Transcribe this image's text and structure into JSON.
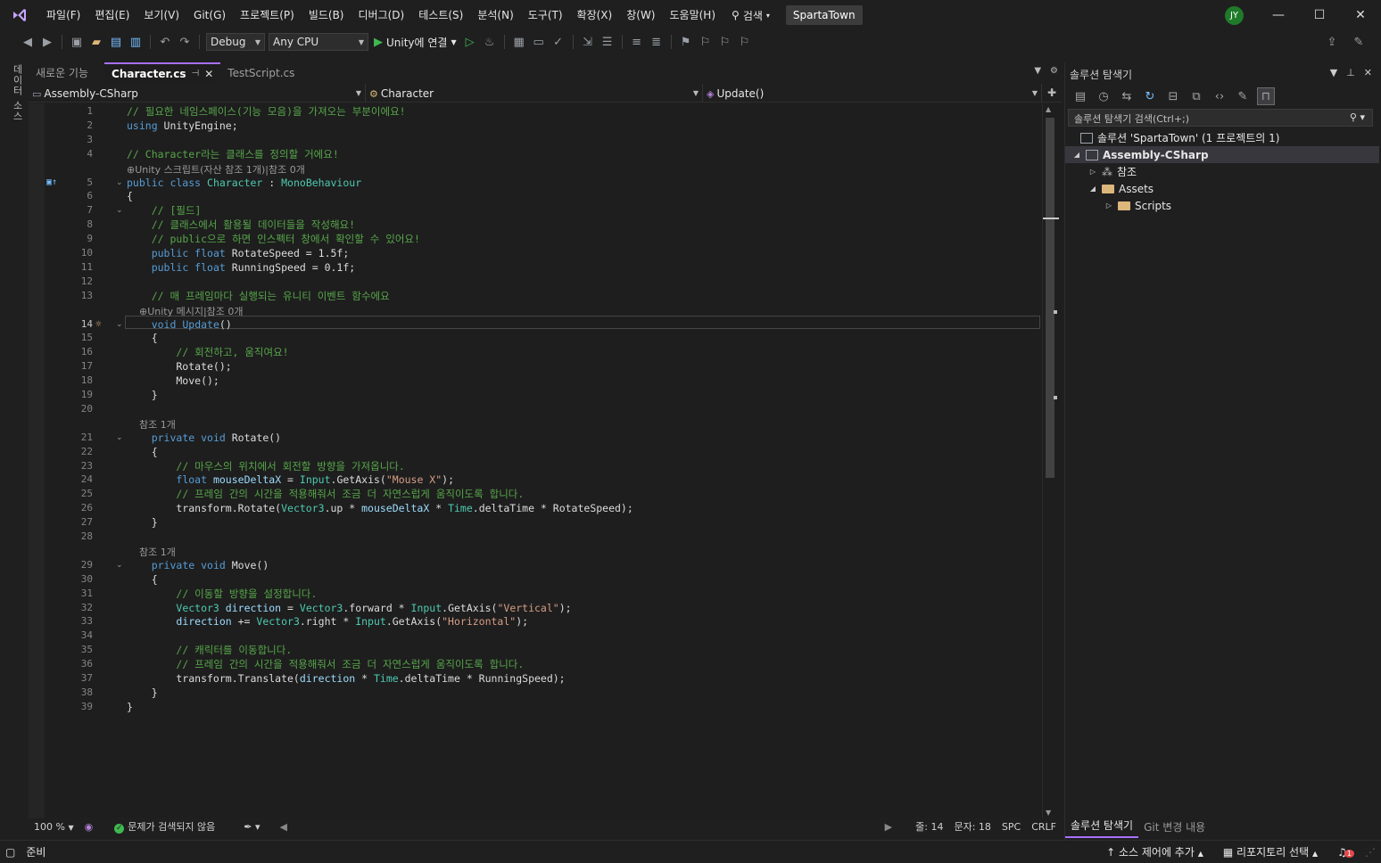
{
  "menu": [
    "파일(F)",
    "편집(E)",
    "보기(V)",
    "Git(G)",
    "프로젝트(P)",
    "빌드(B)",
    "디버그(D)",
    "테스트(S)",
    "분석(N)",
    "도구(T)",
    "확장(X)",
    "창(W)",
    "도움말(H)"
  ],
  "search_label": "검색",
  "solution_name": "SpartaTown",
  "user_initials": "JY",
  "toolbar": {
    "config": "Debug",
    "platform": "Any CPU",
    "run_label": "Unity에 연결"
  },
  "left_rail": "데이터 소스",
  "tabs": [
    {
      "label": "새로운 기능"
    },
    {
      "label": "Character.cs"
    },
    {
      "label": "TestScript.cs"
    }
  ],
  "nav": {
    "project": "Assembly-CSharp",
    "class": "Character",
    "member": "Update()"
  },
  "code_lines": [
    {
      "n": "1",
      "html": "<span class='c-com'>// 필요한 네임스페이스(기능 모음)을 가져오는 부분이에요!</span>"
    },
    {
      "n": "2",
      "html": "<span class='c-kw'>using</span> UnityEngine;"
    },
    {
      "n": "3",
      "html": ""
    },
    {
      "n": "4",
      "html": "<span class='c-com'>// Character라는 클래스를 정의할 거에요!</span>"
    },
    {
      "lens": "⊕Unity 스크립트(자산 참조 1개)|참조 0개"
    },
    {
      "n": "5",
      "html": "<span class='c-kw'>public class</span> <span class='c-typ'>Character</span> : <span class='c-typ'>MonoBehaviour</span>"
    },
    {
      "n": "6",
      "html": "{"
    },
    {
      "n": "7",
      "html": "    <span class='c-com'>// [필드]</span>"
    },
    {
      "n": "8",
      "html": "    <span class='c-com'>// 클래스에서 활용될 데이터들을 작성해요!</span>"
    },
    {
      "n": "9",
      "html": "    <span class='c-com'>// public으로 하면 인스펙터 창에서 확인할 수 있어요!</span>"
    },
    {
      "n": "10",
      "html": "    <span class='c-kw'>public float</span> RotateSpeed = 1.5f;"
    },
    {
      "n": "11",
      "html": "    <span class='c-kw'>public float</span> RunningSpeed = 0.1f;"
    },
    {
      "n": "12",
      "html": ""
    },
    {
      "n": "13",
      "html": "    <span class='c-com'>// 매 프레임마다 실행되는 유니티 이벤트 함수에요</span>"
    },
    {
      "lens": "    ⊕Unity 메시지|참조 0개"
    },
    {
      "n": "14",
      "html": "    <span class='c-kw'>void</span> <span class='c-kw'>Update</span>()"
    },
    {
      "n": "15",
      "html": "    {"
    },
    {
      "n": "16",
      "html": "        <span class='c-com'>// 회전하고, 움직여요!</span>"
    },
    {
      "n": "17",
      "html": "        Rotate();"
    },
    {
      "n": "18",
      "html": "        Move();"
    },
    {
      "n": "19",
      "html": "    }"
    },
    {
      "n": "20",
      "html": ""
    },
    {
      "lens": "    참조 1개"
    },
    {
      "n": "21",
      "html": "    <span class='c-kw'>private void</span> Rotate()"
    },
    {
      "n": "22",
      "html": "    {"
    },
    {
      "n": "23",
      "html": "        <span class='c-com'>// 마우스의 위치에서 회전할 방향을 가져옵니다.</span>"
    },
    {
      "n": "24",
      "html": "        <span class='c-kw'>float</span> <span class='c-var'>mouseDeltaX</span> = <span class='c-typ'>Input</span>.GetAxis(<span class='c-str'>\"Mouse X\"</span>);"
    },
    {
      "n": "25",
      "html": "        <span class='c-com'>// 프레임 간의 시간을 적용해줘서 조금 더 자연스럽게 움직이도록 합니다.</span>"
    },
    {
      "n": "26",
      "html": "        transform.Rotate(<span class='c-typ'>Vector3</span>.up * <span class='c-var'>mouseDeltaX</span> * <span class='c-typ'>Time</span>.deltaTime * RotateSpeed);"
    },
    {
      "n": "27",
      "html": "    }"
    },
    {
      "n": "28",
      "html": ""
    },
    {
      "lens": "    참조 1개"
    },
    {
      "n": "29",
      "html": "    <span class='c-kw'>private void</span> Move()"
    },
    {
      "n": "30",
      "html": "    {"
    },
    {
      "n": "31",
      "html": "        <span class='c-com'>// 이동할 방향을 설정합니다.</span>"
    },
    {
      "n": "32",
      "html": "        <span class='c-typ'>Vector3</span> <span class='c-var'>direction</span> = <span class='c-typ'>Vector3</span>.forward * <span class='c-typ'>Input</span>.GetAxis(<span class='c-str'>\"Vertical\"</span>);"
    },
    {
      "n": "33",
      "html": "        <span class='c-var'>direction</span> += <span class='c-typ'>Vector3</span>.right * <span class='c-typ'>Input</span>.GetAxis(<span class='c-str'>\"Horizontal\"</span>);"
    },
    {
      "n": "34",
      "html": ""
    },
    {
      "n": "35",
      "html": "        <span class='c-com'>// 캐릭터를 이동합니다.</span>"
    },
    {
      "n": "36",
      "html": "        <span class='c-com'>// 프레임 간의 시간을 적용해줘서 조금 더 자연스럽게 움직이도록 합니다.</span>"
    },
    {
      "n": "37",
      "html": "        transform.Translate(<span class='c-var'>direction</span> * <span class='c-typ'>Time</span>.deltaTime * RunningSpeed);"
    },
    {
      "n": "38",
      "html": "    }"
    },
    {
      "n": "39",
      "html": "}"
    }
  ],
  "editor_status": {
    "zoom": "100 %",
    "issues": "문제가 검색되지 않음",
    "line": "줄: 14",
    "col": "문자: 18",
    "spc": "SPC",
    "eol": "CRLF"
  },
  "solution_explorer": {
    "title": "솔루션 탐색기",
    "search_placeholder": "솔루션 탐색기 검색(Ctrl+;)",
    "tree": [
      {
        "label": "솔루션 'SpartaTown' (1 프로젝트의 1)",
        "icon": "solution-icon"
      },
      {
        "label": "Assembly-CSharp",
        "icon": "project-icon"
      },
      {
        "label": "참조",
        "icon": "references-icon"
      },
      {
        "label": "Assets",
        "icon": "folder-icon"
      },
      {
        "label": "Scripts",
        "icon": "folder-icon"
      }
    ],
    "tabs": [
      "솔루션 탐색기",
      "Git 변경 내용"
    ]
  },
  "statusbar": {
    "ready": "준비",
    "source_control": "소스 제어에 추가",
    "repo": "리포지토리 선택",
    "notifications": "1"
  }
}
